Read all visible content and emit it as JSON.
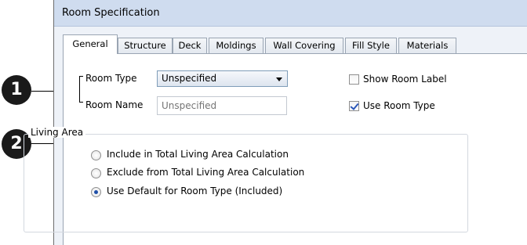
{
  "dialog": {
    "title": "Room Specification"
  },
  "tabs": [
    {
      "label": "General",
      "active": true
    },
    {
      "label": "Structure"
    },
    {
      "label": "Deck"
    },
    {
      "label": "Moldings"
    },
    {
      "label": "Wall Covering"
    },
    {
      "label": "Fill Style"
    },
    {
      "label": "Materials"
    }
  ],
  "room_type": {
    "label": "Room Type",
    "value": "Unspecified"
  },
  "room_name": {
    "label": "Room Name",
    "placeholder": "Unspecified"
  },
  "show_room_label": {
    "label": "Show Room Label",
    "checked": false
  },
  "use_room_type": {
    "label": "Use Room Type",
    "checked": true
  },
  "living_area": {
    "label": "Living Area",
    "options": [
      {
        "label": "Include in Total Living Area Calculation",
        "selected": false
      },
      {
        "label": "Exclude from Total Living Area Calculation",
        "selected": false
      },
      {
        "label": "Use Default for Room Type (Included)",
        "selected": true
      }
    ]
  },
  "callouts": [
    "1",
    "2"
  ]
}
